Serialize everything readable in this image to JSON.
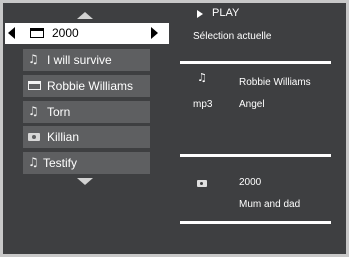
{
  "navigator": {
    "current_folder": "2000",
    "items": [
      {
        "icon": "music-note-icon",
        "label": "I will survive"
      },
      {
        "icon": "folder-icon",
        "label": "Robbie Williams"
      },
      {
        "icon": "music-note-icon",
        "label": "Torn"
      },
      {
        "icon": "camera-icon",
        "label": "Killian"
      },
      {
        "icon": "music-note-icon",
        "label": "Testify"
      }
    ]
  },
  "details": {
    "play_label": "PLAY",
    "selection_title": "Sélection actuelle",
    "track": {
      "artist": "Robbie Williams",
      "format": "mp3",
      "title": "Angel"
    },
    "album": {
      "year": "2000",
      "name": "Mum and dad"
    }
  },
  "colors": {
    "background": "#3e3f41",
    "item_bg": "#5e5f61",
    "selected_bg": "#ffffff",
    "text": "#ffffff"
  }
}
